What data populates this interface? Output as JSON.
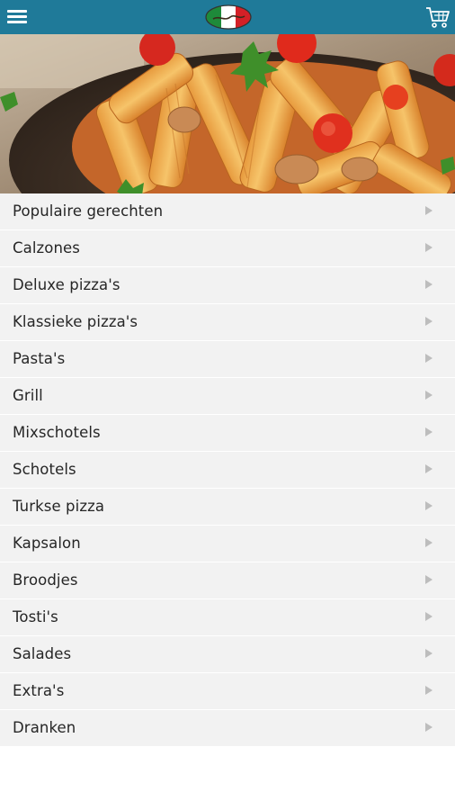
{
  "header": {
    "menu_icon": "hamburger-menu-icon",
    "logo_icon": "restaurant-logo-icon",
    "logo_colors": [
      "#1e8a3a",
      "#ffffff",
      "#d42027"
    ],
    "cart_icon": "shopping-cart-icon",
    "bar_color": "#1f7a99"
  },
  "hero": {
    "image": "pasta-penne-dish-photo"
  },
  "menu": {
    "items": [
      {
        "label": "Populaire gerechten"
      },
      {
        "label": "Calzones"
      },
      {
        "label": "Deluxe pizza's"
      },
      {
        "label": "Klassieke pizza's"
      },
      {
        "label": "Pasta's"
      },
      {
        "label": "Grill"
      },
      {
        "label": "Mixschotels"
      },
      {
        "label": "Schotels"
      },
      {
        "label": "Turkse pizza"
      },
      {
        "label": "Kapsalon"
      },
      {
        "label": "Broodjes"
      },
      {
        "label": "Tosti's"
      },
      {
        "label": "Salades"
      },
      {
        "label": "Extra's"
      },
      {
        "label": "Dranken"
      }
    ],
    "arrow_icon": "chevron-right-icon"
  }
}
